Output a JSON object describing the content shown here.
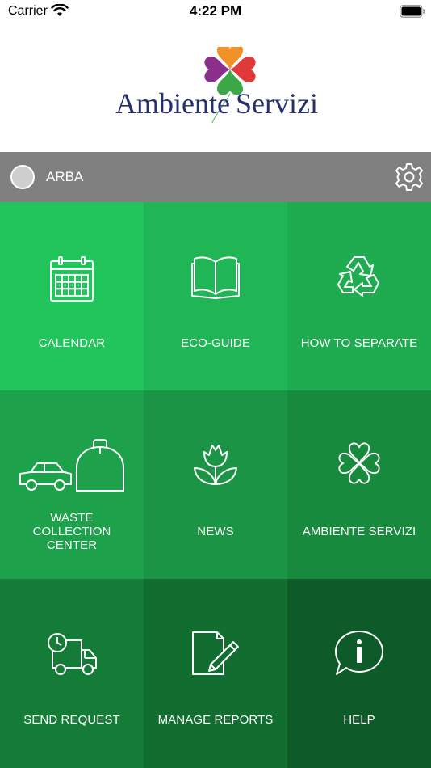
{
  "status_bar": {
    "carrier": "Carrier",
    "time": "4:22 PM"
  },
  "logo": {
    "text_left": "Ambiente",
    "text_right": "Servizi"
  },
  "location": {
    "name": "ARBA"
  },
  "tiles": [
    {
      "label": "CALENDAR",
      "icon": "calendar-icon",
      "color": "#22c55c"
    },
    {
      "label": "ECO-GUIDE",
      "icon": "book-icon",
      "color": "#20b656"
    },
    {
      "label": "HOW TO SEPARATE",
      "icon": "recycle-icon",
      "color": "#1fac51"
    },
    {
      "label": "WASTE COLLECTION CENTER",
      "icon": "car-and-bin-icon",
      "color": "#1da14b"
    },
    {
      "label": "NEWS",
      "icon": "tulip-icon",
      "color": "#1b9545"
    },
    {
      "label": "AMBIENTE SERVIZI",
      "icon": "clover-icon",
      "color": "#178a3d"
    },
    {
      "label": "SEND REQUEST",
      "icon": "delivery-truck-icon",
      "color": "#157c37"
    },
    {
      "label": "MANAGE REPORTS",
      "icon": "document-pen-icon",
      "color": "#126d31"
    },
    {
      "label": "HELP",
      "icon": "info-bubble-icon",
      "color": "#0e5a28"
    }
  ]
}
